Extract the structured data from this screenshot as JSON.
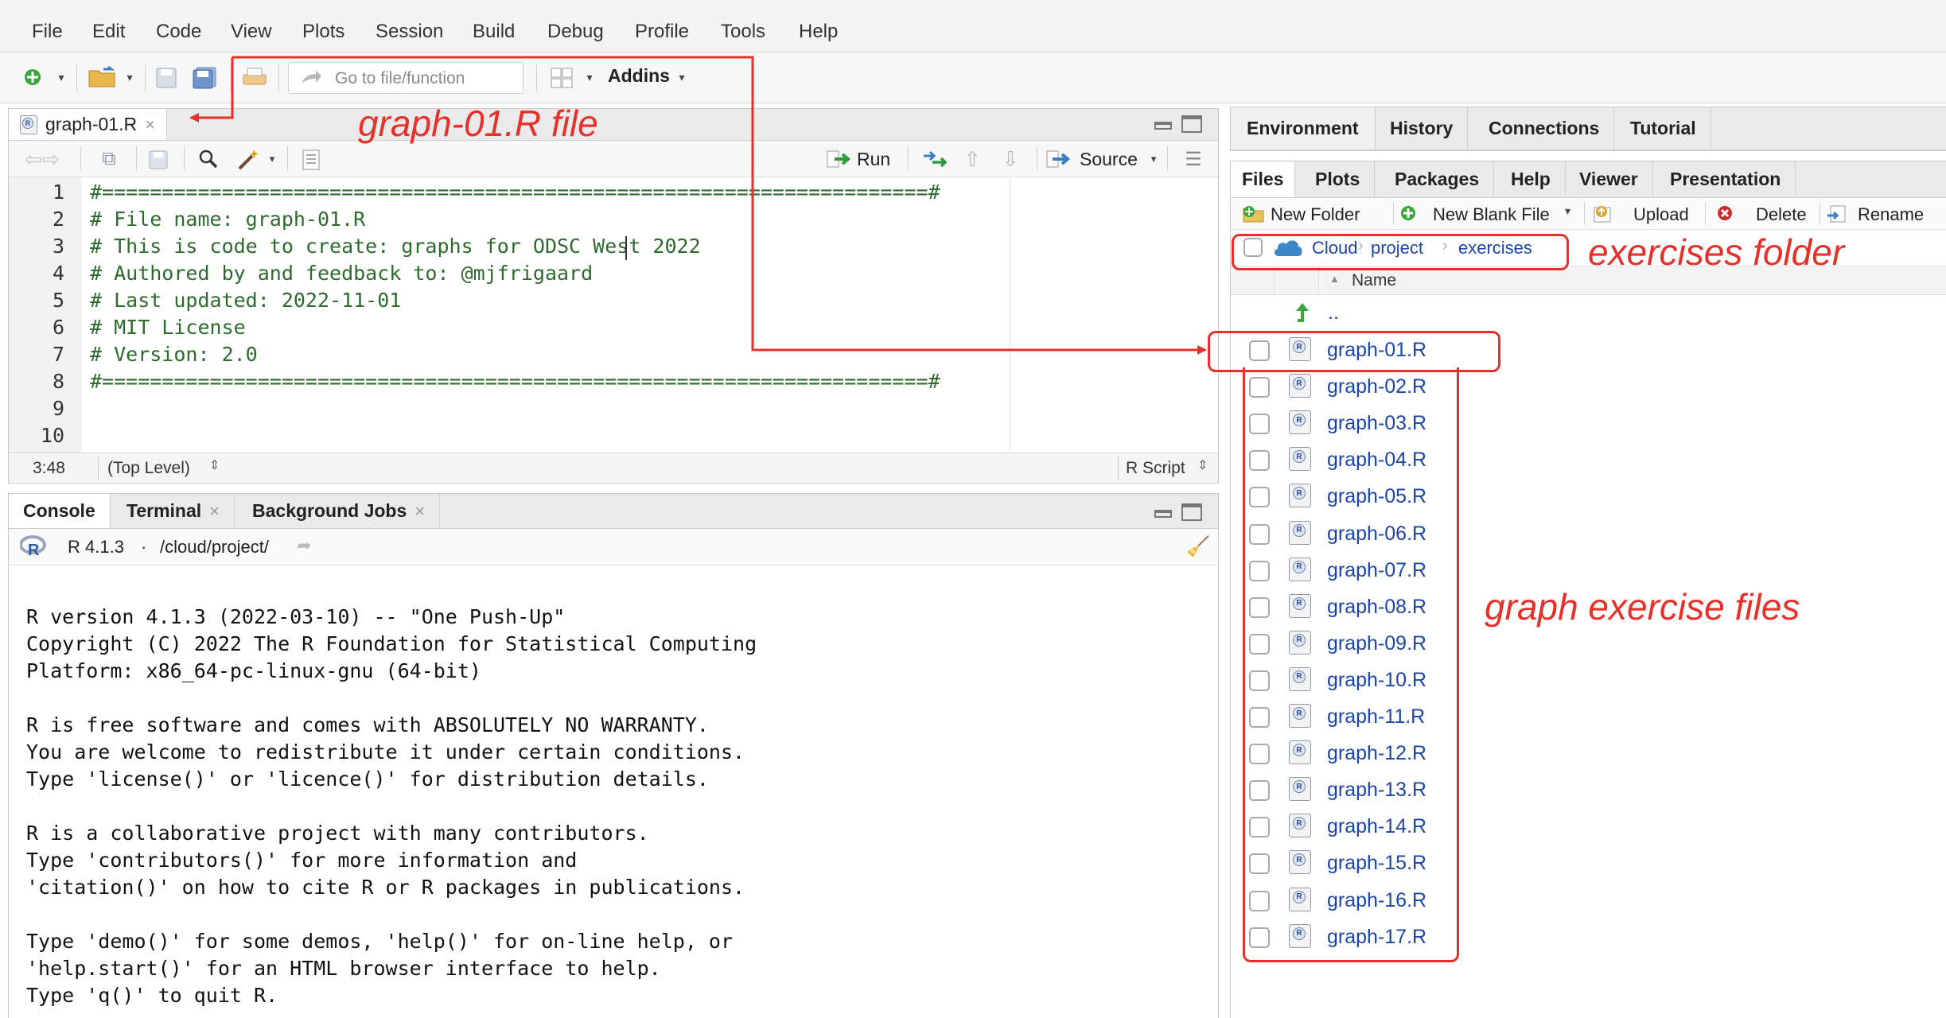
{
  "menu": [
    "File",
    "Edit",
    "Code",
    "View",
    "Plots",
    "Session",
    "Build",
    "Debug",
    "Profile",
    "Tools",
    "Help"
  ],
  "toolbar": {
    "goto_placeholder": "Go to file/function",
    "addins_label": "Addins"
  },
  "editor": {
    "tab_label": "graph-01.R",
    "run_label": "Run",
    "source_label": "Source",
    "line_numbers": [
      "1",
      "2",
      "3",
      "4",
      "5",
      "6",
      "7",
      "8",
      "9",
      "10"
    ],
    "lines": [
      "#=====================================================================#",
      "# File name: graph-01.R",
      "# This is code to create: graphs for ODSC West 2022",
      "# Authored by and feedback to: @mjfrigaard",
      "# Last updated: 2022-11-01",
      "# MIT License",
      "# Version: 2.0",
      "#=====================================================================#",
      "",
      ""
    ],
    "status_position": "3:48",
    "status_scope": "(Top Level)",
    "status_type": "R Script"
  },
  "console": {
    "tabs": [
      "Console",
      "Terminal",
      "Background Jobs"
    ],
    "version": "R 4.1.3",
    "path": "/cloud/project/",
    "lines": [
      "R version 4.1.3 (2022-03-10) -- \"One Push-Up\"",
      "Copyright (C) 2022 The R Foundation for Statistical Computing",
      "Platform: x86_64-pc-linux-gnu (64-bit)",
      "",
      "R is free software and comes with ABSOLUTELY NO WARRANTY.",
      "You are welcome to redistribute it under certain conditions.",
      "Type 'license()' or 'licence()' for distribution details.",
      "",
      "R is a collaborative project with many contributors.",
      "Type 'contributors()' for more information and",
      "'citation()' on how to cite R or R packages in publications.",
      "",
      "Type 'demo()' for some demos, 'help()' for on-line help, or",
      "'help.start()' for an HTML browser interface to help.",
      "Type 'q()' to quit R."
    ]
  },
  "env_tabs": [
    "Environment",
    "History",
    "Connections",
    "Tutorial"
  ],
  "files": {
    "tabs": [
      "Files",
      "Plots",
      "Packages",
      "Help",
      "Viewer",
      "Presentation"
    ],
    "actions": {
      "new_folder": "New Folder",
      "new_blank_file": "New Blank File",
      "upload": "Upload",
      "delete": "Delete",
      "rename": "Rename"
    },
    "breadcrumb": [
      "Cloud",
      "project",
      "exercises"
    ],
    "column_name": "Name",
    "parent_dir": "..",
    "items": [
      "graph-01.R",
      "graph-02.R",
      "graph-03.R",
      "graph-04.R",
      "graph-05.R",
      "graph-06.R",
      "graph-07.R",
      "graph-08.R",
      "graph-09.R",
      "graph-10.R",
      "graph-11.R",
      "graph-12.R",
      "graph-13.R",
      "graph-14.R",
      "graph-15.R",
      "graph-16.R",
      "graph-17.R"
    ]
  },
  "annotations": {
    "file_note": "graph-01.R file",
    "folder_note": "exercises folder",
    "files_note": "graph exercise files"
  },
  "colors": {
    "annotation_red": "#e5312a",
    "file_link_blue": "#1b45a8",
    "comment_green": "#2d6b2d"
  }
}
